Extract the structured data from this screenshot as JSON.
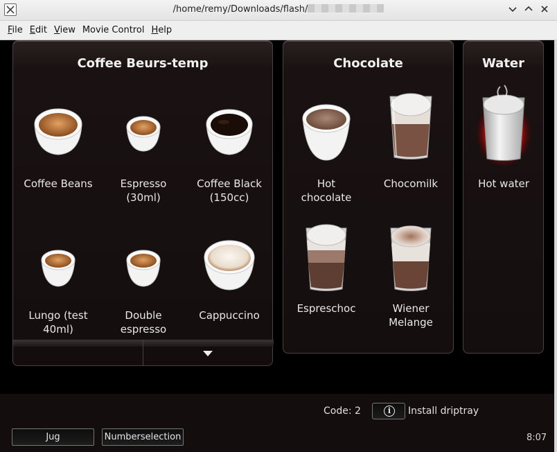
{
  "window": {
    "title": "/home/remy/Downloads/flash/",
    "controls": [
      "chevron-down-icon",
      "chevron-up-icon",
      "close-icon"
    ]
  },
  "menu": [
    {
      "label": "File",
      "underline": "F",
      "rest": "ile"
    },
    {
      "label": "Edit",
      "underline": "E",
      "rest": "dit"
    },
    {
      "label": "View",
      "underline": "V",
      "rest": "iew"
    },
    {
      "label": "Movie Control",
      "underline": "",
      "rest": "Movie Control"
    },
    {
      "label": "Help",
      "underline": "H",
      "rest": "elp"
    }
  ],
  "panels": {
    "coffee": {
      "title": "Coffee Beurs-temp",
      "products": [
        {
          "l1": "Coffee Beans",
          "l2": "",
          "icon": "coffee-beans-cup-icon"
        },
        {
          "l1": "Espresso",
          "l2": "(30ml)",
          "icon": "espresso-cup-icon"
        },
        {
          "l1": "Coffee Black",
          "l2": "(150cc)",
          "icon": "black-coffee-cup-icon"
        },
        {
          "l1": "Lungo (test",
          "l2": "40ml)",
          "icon": "lungo-cup-icon"
        },
        {
          "l1": "Double",
          "l2": "espresso",
          "icon": "double-espresso-cup-icon"
        },
        {
          "l1": "Cappuccino",
          "l2": "",
          "icon": "cappuccino-cup-icon"
        }
      ]
    },
    "chocolate": {
      "title": "Chocolate",
      "products": [
        {
          "l1": "Hot",
          "l2": "chocolate",
          "icon": "hot-chocolate-cup-icon"
        },
        {
          "l1": "Chocomilk",
          "l2": "",
          "icon": "chocomilk-glass-icon"
        },
        {
          "l1": "Espreschoc",
          "l2": "",
          "icon": "espreschoc-glass-icon"
        },
        {
          "l1": "Wiener",
          "l2": "Melange",
          "icon": "wiener-melange-glass-icon"
        }
      ]
    },
    "water": {
      "title": "Water",
      "products": [
        {
          "l1": "Hot water",
          "l2": "",
          "icon": "hot-water-glass-icon"
        }
      ]
    }
  },
  "status": {
    "code": "Code: 2",
    "info_label": "Install driptray"
  },
  "buttons": {
    "jug": "Jug",
    "numberselection": "Numberselection"
  },
  "clock": "8:07"
}
